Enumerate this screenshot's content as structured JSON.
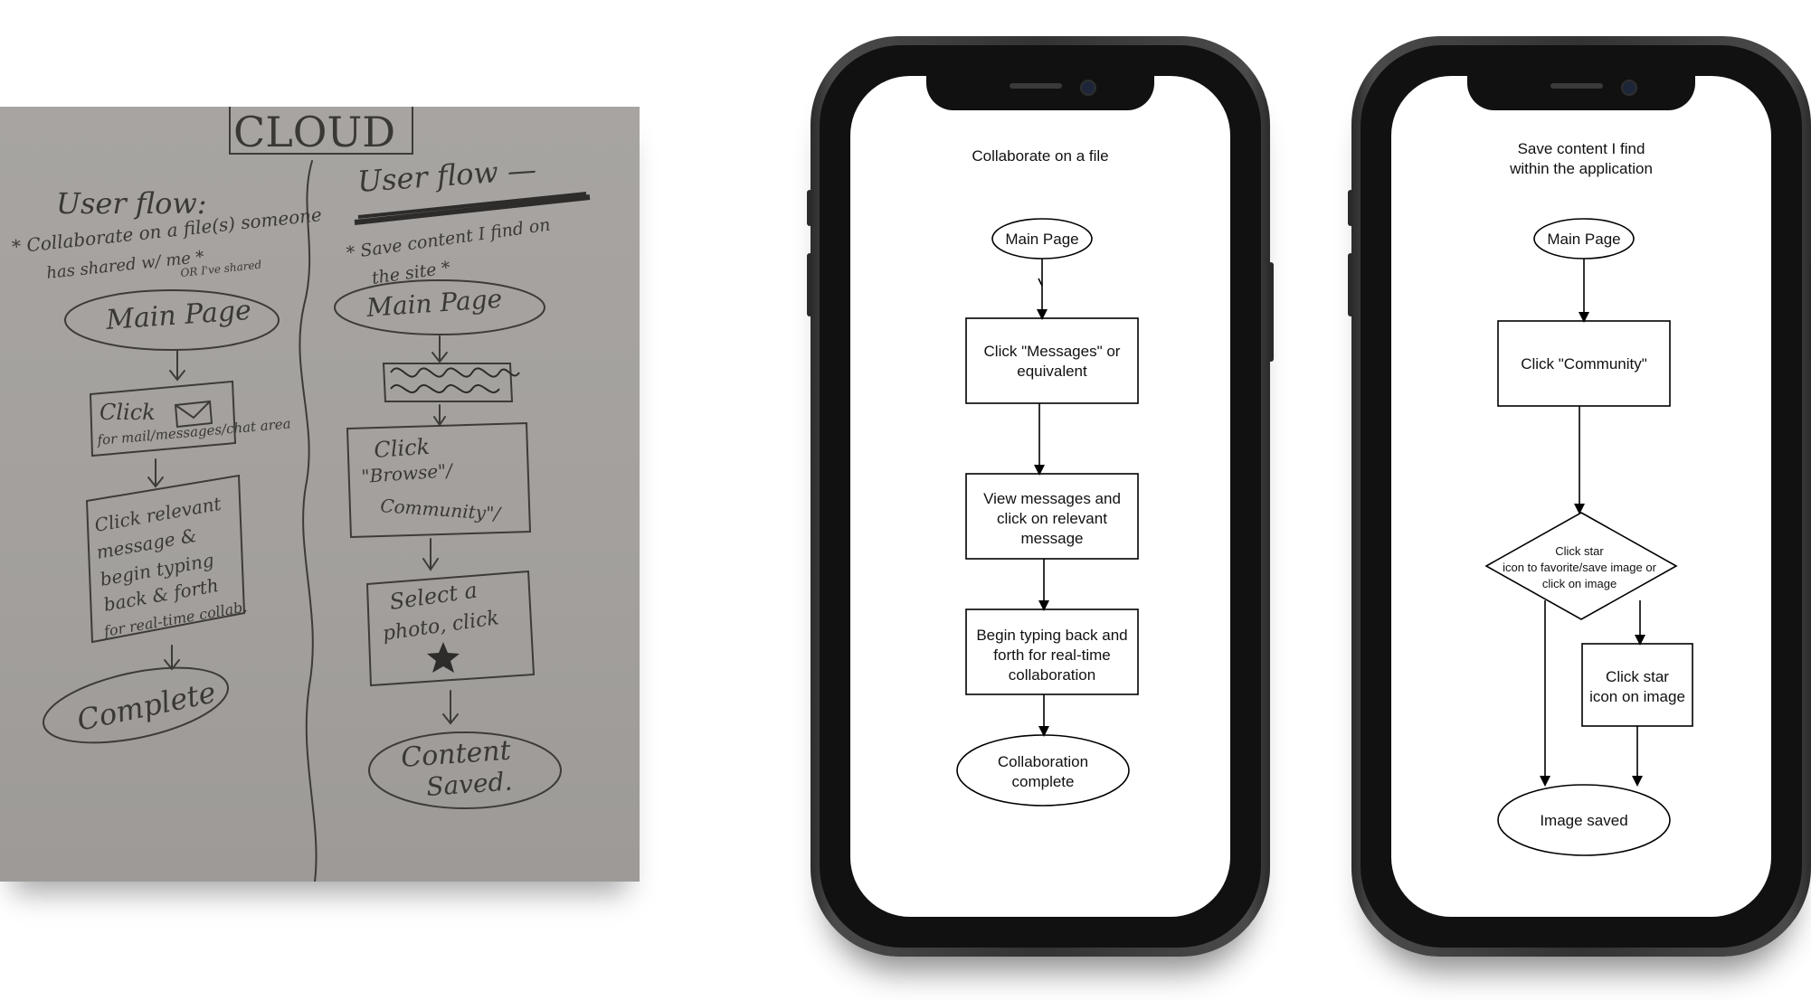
{
  "sketch": {
    "title": "CLOUD",
    "left_heading": "User flow:",
    "left_desc_1": "* Collaborate on a file(s) someone",
    "left_desc_2": "has shared w/ me *",
    "left_desc_3": "OR I've shared",
    "left_main": "Main Page",
    "left_click_1": "Click",
    "left_click_2": "for mail/messages/chat area",
    "left_msg_1": "Click relevant",
    "left_msg_2": "message &",
    "left_msg_3": "begin typing",
    "left_msg_4": "back & forth",
    "left_msg_5": "for real-time collab.",
    "left_end": "Complete",
    "right_heading": "User flow —",
    "right_desc_1": "* Save content I find on",
    "right_desc_2": "the site *",
    "right_main": "Main Page",
    "right_browse_1": "Click",
    "right_browse_2": "\"Browse\"/",
    "right_browse_3": "Community\"/",
    "right_select_1": "Select a",
    "right_select_2": "photo, click",
    "right_end_1": "Content",
    "right_end_2": "Saved."
  },
  "phone1": {
    "title": "Collaborate on a file",
    "start": "Main Page",
    "step1_l1": "Click \"Messages\" or",
    "step1_l2": "equivalent",
    "step2_l1": "View messages and",
    "step2_l2": "click on relevant",
    "step2_l3": "message",
    "step3_l1": "Begin typing back and",
    "step3_l2": "forth for real-time",
    "step3_l3": "collaboration",
    "end_l1": "Collaboration",
    "end_l2": "complete"
  },
  "phone2": {
    "title_l1": "Save content I find",
    "title_l2": "within the application",
    "start": "Main Page",
    "step1": "Click \"Community\"",
    "decision_l1": "Click star",
    "decision_l2": "icon to favorite/save image or",
    "decision_l3": "click on image",
    "step2_l1": "Click  star",
    "step2_l2": "icon on image",
    "end": "Image saved"
  }
}
